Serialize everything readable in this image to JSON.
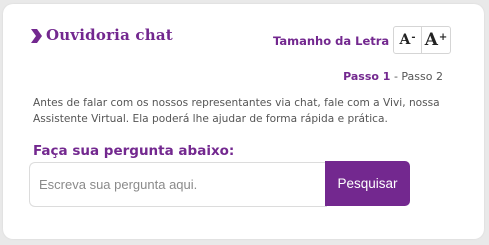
{
  "header": {
    "title": "Ouvidoria chat",
    "chevron_icon": "chevron-right-icon",
    "font_size_label": "Tamanho da Letra",
    "decrease_font_label": "A",
    "decrease_font_suffix": "-",
    "increase_font_label": "A",
    "increase_font_suffix": "+"
  },
  "steps": {
    "current": "Passo 1",
    "separator": "-",
    "next": "Passo 2"
  },
  "intro_text": "Antes de falar com os nossos representantes via chat, fale com a Vivi, nossa Assistente Virtual. Ela poderá lhe ajudar de forma rápida e prática.",
  "question": {
    "label": "Faça sua pergunta abaixo:",
    "input_value": "",
    "input_placeholder": "Escreva sua pergunta aqui.",
    "submit_label": "Pesquisar"
  },
  "colors": {
    "brand_purple": "#73288f",
    "background": "#e9e9e9",
    "card": "#ffffff"
  }
}
